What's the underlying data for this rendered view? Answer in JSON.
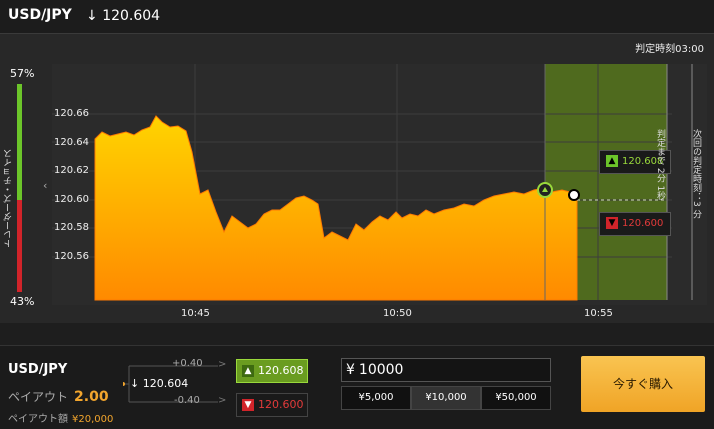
{
  "header": {
    "pair": "USD/JPY",
    "price": "120.604"
  },
  "chart": {
    "judge_time": "判定時刻03:00",
    "trader_choice": {
      "label": "トレーダーズ・チョイス",
      "up_pct": "57%",
      "down_pct": "43%",
      "up_fraction": 0.57
    },
    "y_ticks": [
      "120.66",
      "120.64",
      "120.62",
      "120.60",
      "120.58",
      "120.56"
    ],
    "x_ticks": [
      "10:45",
      "10:50",
      "10:55"
    ],
    "up_rate": "120.608",
    "down_rate": "120.600",
    "vertical_label_1": "判定まで 2分 1秒",
    "vertical_label_2": "次回の判定時刻：3 分",
    "colors": {
      "area_top": "#ffd400",
      "area_bottom": "#ff8a00",
      "zone": "#4f6a1e",
      "up": "#6cc52a",
      "down": "#d1242a"
    }
  },
  "bottom": {
    "pair": "USD/JPY",
    "payout_label": "ペイアウト",
    "payout_value": "2.00",
    "payout_amount_label": "ペイアウト額",
    "payout_amount": "¥20,000",
    "price": "120.604",
    "plus": "+0.40",
    "minus": "-0.40",
    "up_rate": "120.608",
    "down_rate": "120.600",
    "yen_symbol": "¥",
    "amount": "10000",
    "presets": [
      "¥5,000",
      "¥10,000",
      "¥50,000"
    ],
    "buy_label": "今すぐ購入"
  }
}
